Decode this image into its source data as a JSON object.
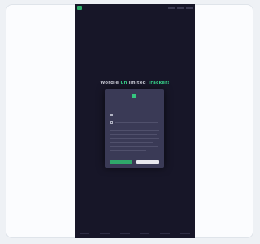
{
  "page": {
    "background": "#eef1f5",
    "card_background": "#fbfcfe"
  },
  "app": {
    "background": "#171628",
    "accent": "#37d089"
  },
  "hero": {
    "part_a": "Wordle ",
    "part_b": "un",
    "part_c": "limited ",
    "part_d": "Tracker!"
  },
  "modal": {
    "text": "",
    "icon": "app-logo-icon"
  }
}
